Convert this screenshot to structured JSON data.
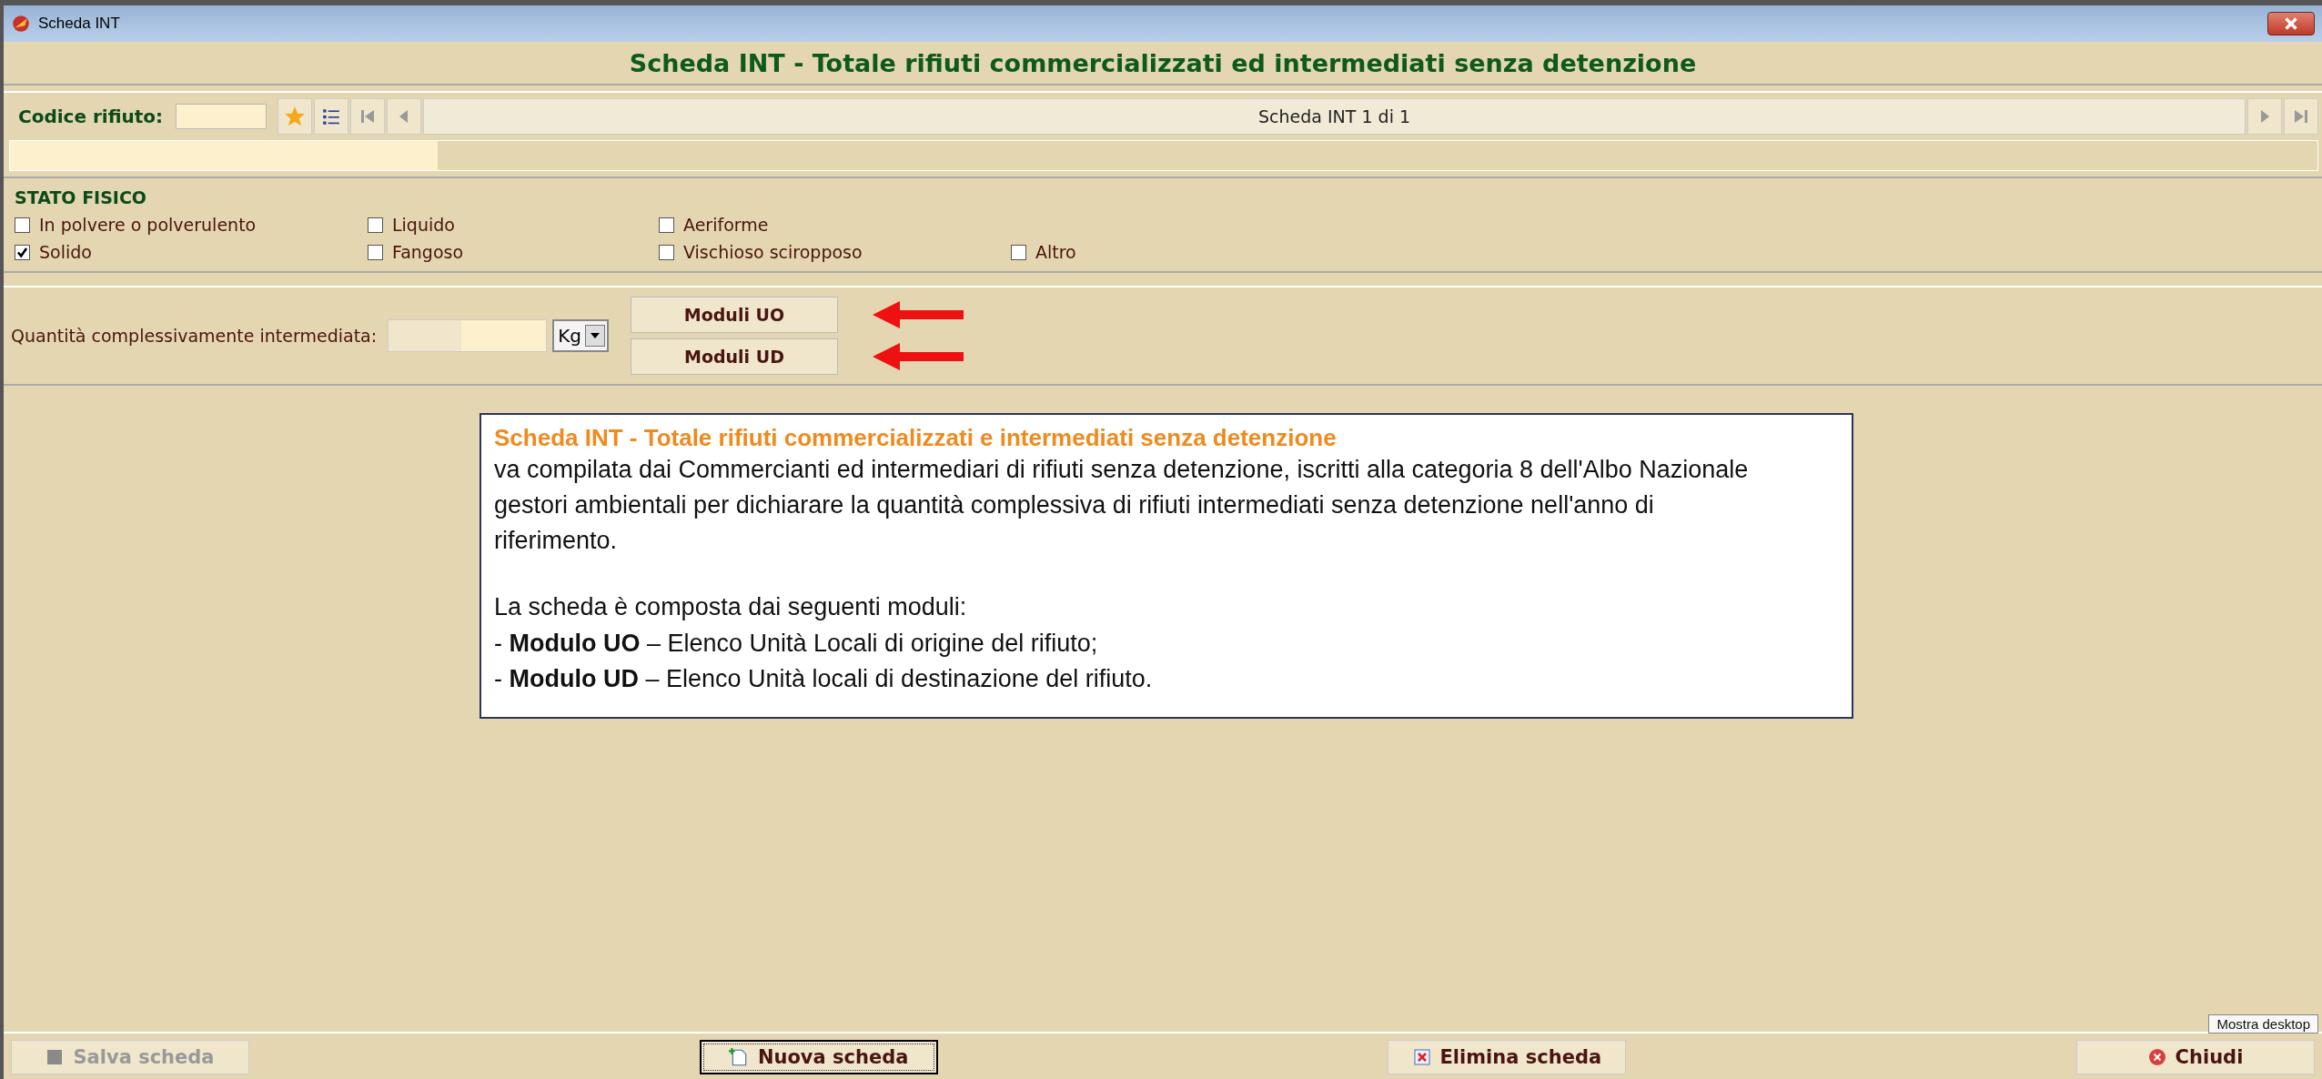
{
  "window": {
    "title": "Scheda INT"
  },
  "header": {
    "title": "Scheda INT - Totale rifiuti commercializzati ed intermediati senza detenzione"
  },
  "record_nav": {
    "code_label": "Codice rifiuto:",
    "position": "Scheda INT 1 di 1"
  },
  "stato_fisico": {
    "title": "STATO FISICO",
    "rows": [
      [
        {
          "label": "In polvere o polverulento",
          "checked": false
        },
        {
          "label": "Liquido",
          "checked": false
        },
        {
          "label": "Aeriforme",
          "checked": false
        }
      ],
      [
        {
          "label": "Solido",
          "checked": true
        },
        {
          "label": "Fangoso",
          "checked": false
        },
        {
          "label": "Vischioso sciropposo",
          "checked": false
        },
        {
          "label": "Altro",
          "checked": false
        }
      ]
    ]
  },
  "quantity": {
    "label": "Quantità complessivamente intermediata:",
    "unit": "Kg",
    "buttons": [
      "Moduli UO",
      "Moduli UD"
    ]
  },
  "info": {
    "title": "Scheda INT - Totale rifiuti commercializzati e intermediati senza detenzione",
    "paragraph": "va compilata dai Commercianti ed intermediari di rifiuti senza detenzione, iscritti alla categoria 8 dell'Albo Nazionale gestori ambientali per dichiarare la quantità complessiva di rifiuti intermediati senza detenzione nell'anno di riferimento.",
    "intro": "La scheda è composta dai seguenti moduli:",
    "items": [
      "- **Modulo UO** – Elenco Unità Locali di origine del rifiuto;",
      "- **Modulo UD** – Elenco Unità locali di destinazione del rifiuto."
    ]
  },
  "footer": {
    "buttons": [
      {
        "kind": "save",
        "label": "Salva scheda",
        "disabled": true,
        "focused": false
      },
      {
        "kind": "new",
        "label": "Nuova scheda",
        "disabled": false,
        "focused": true
      },
      {
        "kind": "delete",
        "label": "Elimina scheda",
        "disabled": false,
        "focused": false
      },
      {
        "kind": "close",
        "label": "Chiudi",
        "disabled": false,
        "focused": false
      }
    ]
  },
  "tooltip": "Mostra desktop"
}
